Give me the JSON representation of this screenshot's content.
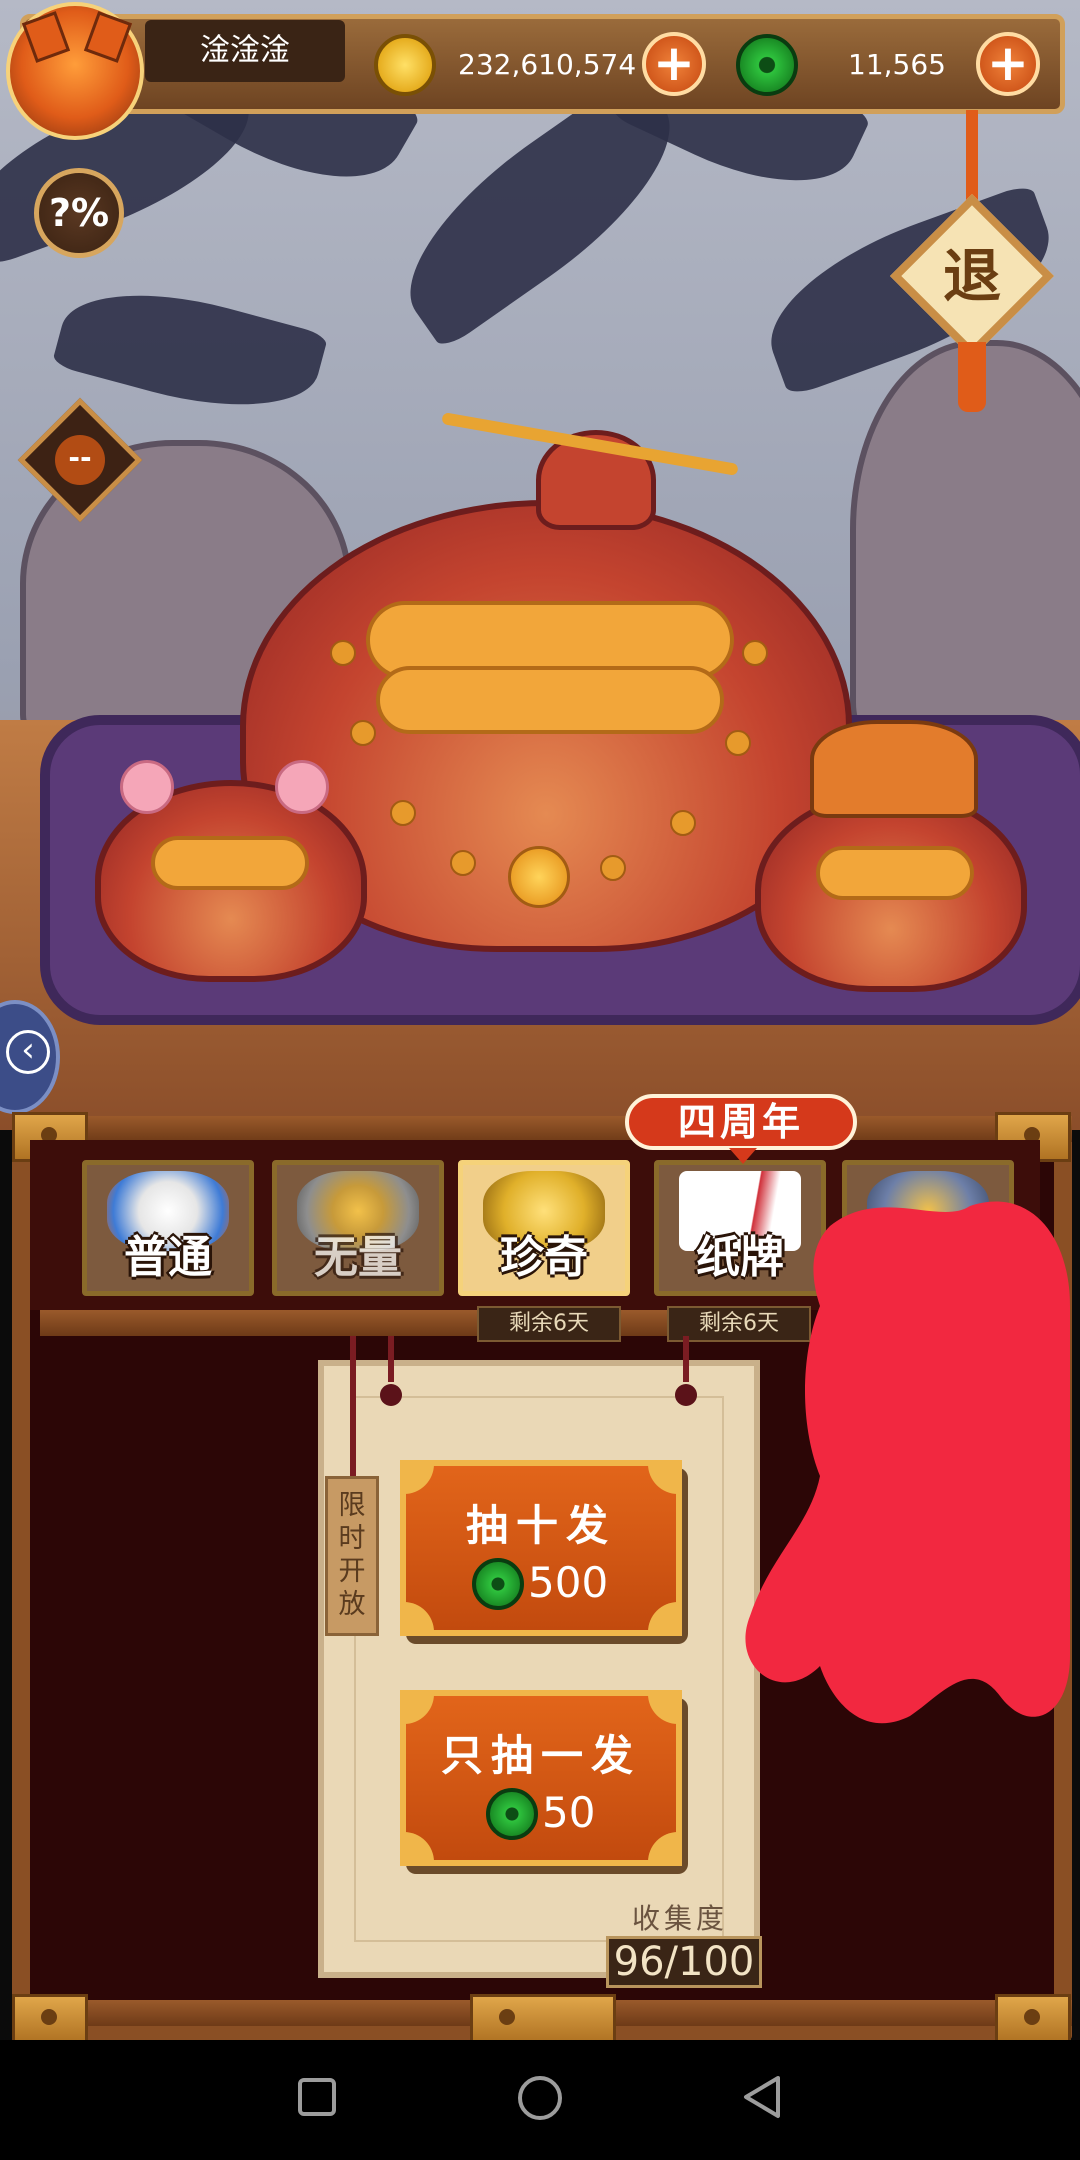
{
  "player": {
    "name": "淦淦淦"
  },
  "currency": {
    "gold_amount": "232,610,574",
    "jade_amount": "11,565",
    "add_symbol": "+"
  },
  "buttons": {
    "odds_label": "?%",
    "exit_label": "退",
    "mute_label": "--",
    "back_arrow": "‹"
  },
  "anniversary_badge": "四周年",
  "tabs": [
    {
      "label": "普通",
      "remaining": ""
    },
    {
      "label": "无量",
      "remaining": ""
    },
    {
      "label": "珍奇",
      "remaining": "剩余6天"
    },
    {
      "label": "纸牌",
      "remaining": "剩余6天"
    },
    {
      "label": "",
      "remaining": ""
    }
  ],
  "limited_tag": "限时开放",
  "draw_ten": {
    "label": "抽十发",
    "price": "500"
  },
  "draw_one": {
    "label": "只抽一发",
    "price": "50"
  },
  "collection": {
    "label": "收集度",
    "value": "96/100"
  },
  "colors": {
    "accent": "#d5391b",
    "gold": "#e6ad1f",
    "jade": "#2ec23d",
    "scribble": "#f22840"
  },
  "icons": {
    "gold": "gold-coin-icon",
    "jade": "jade-coin-icon",
    "nav_recent": "square-icon",
    "nav_home": "circle-icon",
    "nav_back": "triangle-back-icon"
  }
}
